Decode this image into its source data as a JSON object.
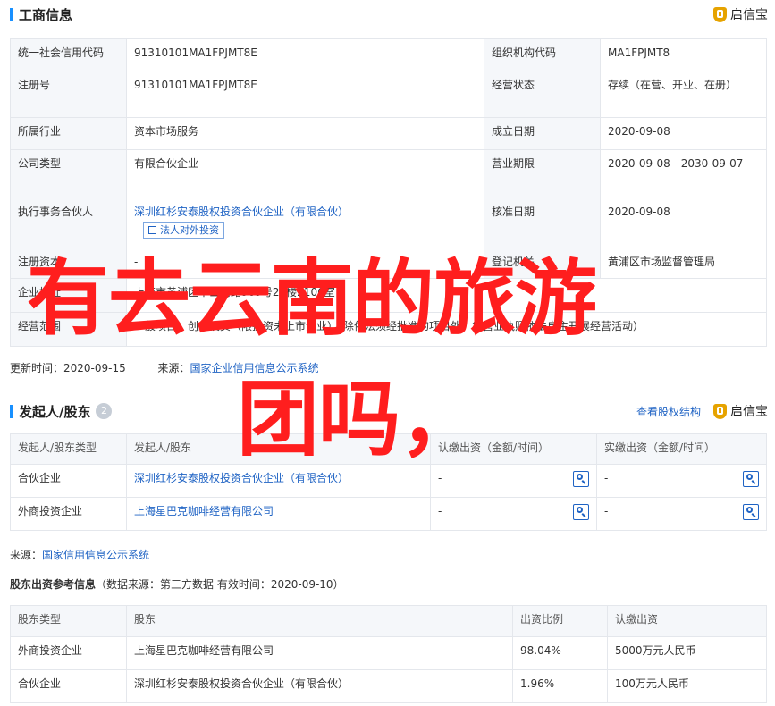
{
  "business_info": {
    "title": "工商信息",
    "brand": "启信宝",
    "rows": [
      {
        "l1": "统一社会信用代码",
        "v1": "91310101MA1FPJMT8E",
        "l2": "组织机构代码",
        "v2": "MA1FPJMT8"
      },
      {
        "l1": "注册号",
        "v1": "91310101MA1FPJMT8E",
        "l2": "经营状态",
        "v2": "存续（在营、开业、在册）"
      },
      {
        "l1": "所属行业",
        "v1": "资本市场服务",
        "l2": "成立日期",
        "v2": "2020-09-08"
      },
      {
        "l1": "公司类型",
        "v1": "有限合伙企业",
        "l2": "营业期限",
        "v2": "2020-09-08 - 2030-09-07"
      },
      {
        "l1": "执行事务合伙人",
        "v1": "深圳红杉安泰股权投资合伙企业（有限合伙）",
        "btn": "法人对外投资",
        "l2": "核准日期",
        "v2": "2020-09-08"
      },
      {
        "l1": "注册资本",
        "v1": "-",
        "l2": "登记机关",
        "v2": "黄浦区市场监督管理局"
      },
      {
        "l1": "企业地址",
        "v1": "上海市黄浦区中山南路969号21楼2106室",
        "l2": "",
        "v2": ""
      },
      {
        "l1": "经营范围",
        "v1": "一般项目：创业投资（限投资未上市企业）（除依法须经批准的项目外，凭营业执照依法自主开展经营活动）",
        "l2": "",
        "v2": ""
      }
    ],
    "update_label": "更新时间：",
    "update_value": "2020-09-15",
    "source_label": "来源：",
    "source_value": "国家企业信用信息公示系统"
  },
  "shareholders": {
    "title": "发起人/股东",
    "count": "2",
    "link": "查看股权结构",
    "brand": "启信宝",
    "headers": [
      "发起人/股东类型",
      "发起人/股东",
      "认缴出资（金额/时间）",
      "实缴出资（金额/时间）"
    ],
    "rows": [
      {
        "type": "合伙企业",
        "name": "深圳红杉安泰股权投资合伙企业（有限合伙）",
        "sub": "-",
        "paid": "-"
      },
      {
        "type": "外商投资企业",
        "name": "上海星巴克咖啡经营有限公司",
        "sub": "-",
        "paid": "-"
      }
    ],
    "source_label": "来源：",
    "source_value": "国家信用信息公示系统"
  },
  "reference": {
    "title": "股东出资参考信息",
    "note": "（数据来源：第三方数据 有效时间：2020-09-10）",
    "headers": [
      "股东类型",
      "股东",
      "出资比例",
      "认缴出资"
    ],
    "rows": [
      {
        "type": "外商投资企业",
        "name": "上海星巴克咖啡经营有限公司",
        "ratio": "98.04%",
        "amount": "5000万元人民币"
      },
      {
        "type": "合伙企业",
        "name": "深圳红杉安泰股权投资合伙企业（有限合伙）",
        "ratio": "1.96%",
        "amount": "100万元人民币"
      }
    ]
  },
  "overlay": {
    "line1": "有去云南的旅游",
    "line2": "团吗，",
    "color": "#ff1e1e"
  }
}
